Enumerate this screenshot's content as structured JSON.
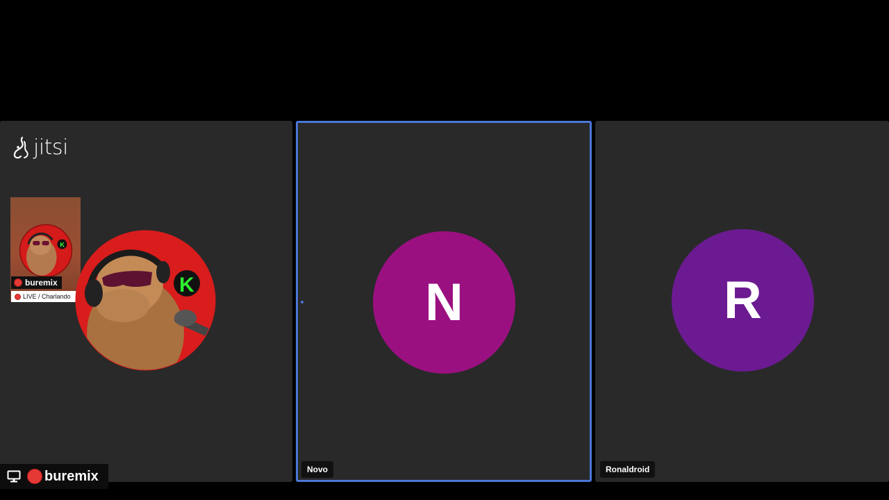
{
  "brand": {
    "logo_text": "jitsi"
  },
  "tiles": {
    "left": {
      "thumbnail_name": "buremix",
      "thumbnail_status": "LIVE / Charlando",
      "screen_share_name": "buremix"
    },
    "middle": {
      "initial": "N",
      "name": "Novo",
      "avatar_color": "#9b1080",
      "active_border_color": "#4a78d6"
    },
    "right": {
      "initial": "R",
      "name": "Ronaldroid",
      "avatar_color": "#6c1a92"
    }
  },
  "colors": {
    "background": "#000000",
    "tile": "#292929",
    "recording_red": "#e53935"
  }
}
